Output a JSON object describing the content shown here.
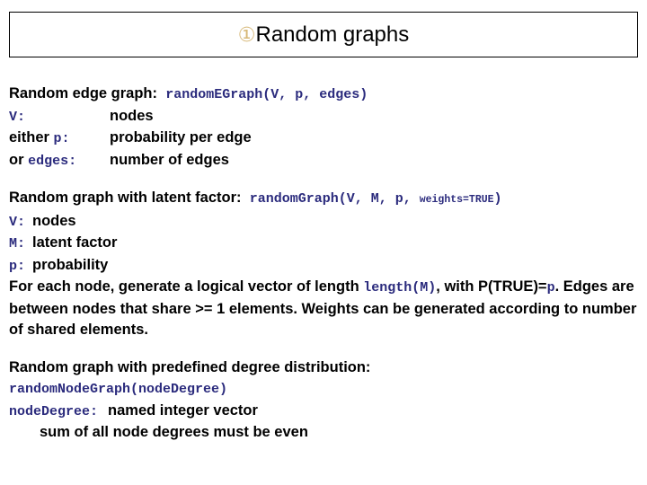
{
  "slide": {
    "title": {
      "marker": "①",
      "marker_name": "circled-four-glyph",
      "marker_color": "#d7b878",
      "text": "Random graphs"
    },
    "background_color": "#ffffff",
    "text_color": "#000000",
    "code_color": "#2b2b7d"
  },
  "sections": [
    {
      "heading_label": "Random edge graph:",
      "heading_code": "randomEGraph(V, p, edges)",
      "rows": [
        {
          "label_code": "V:",
          "label_text": "",
          "desc": "nodes"
        },
        {
          "label_text": "either ",
          "label_code": "p:",
          "desc": "probability per edge"
        },
        {
          "label_text": "or ",
          "label_code": "edges:",
          "desc": "number of edges"
        }
      ]
    },
    {
      "heading_label": "Random graph with latent factor:",
      "heading_code_main": "randomGraph(V, M, p, ",
      "heading_code_small": "weights=TRUE",
      "heading_code_close": ")",
      "rows": [
        {
          "label_code": "V:",
          "desc": "nodes"
        },
        {
          "label_code": "M:",
          "desc": "latent factor"
        },
        {
          "label_code": "p:",
          "desc": "probability"
        }
      ],
      "paragraph": {
        "part1": "For each node, generate a logical vector of length ",
        "code1": "length(M)",
        "part2": ", with P(TRUE)=",
        "code2": "p",
        "part3": ". Edges are between nodes that share >= 1 elements. Weights can be generated according to number of shared elements."
      }
    },
    {
      "heading_label": "Random graph with predefined degree distribution:",
      "code_line": "randomNodeGraph(nodeDegree)",
      "rows": [
        {
          "label_code": "nodeDegree:",
          "desc": "named integer vector"
        }
      ],
      "note": "sum of all node degrees must be even"
    }
  ]
}
